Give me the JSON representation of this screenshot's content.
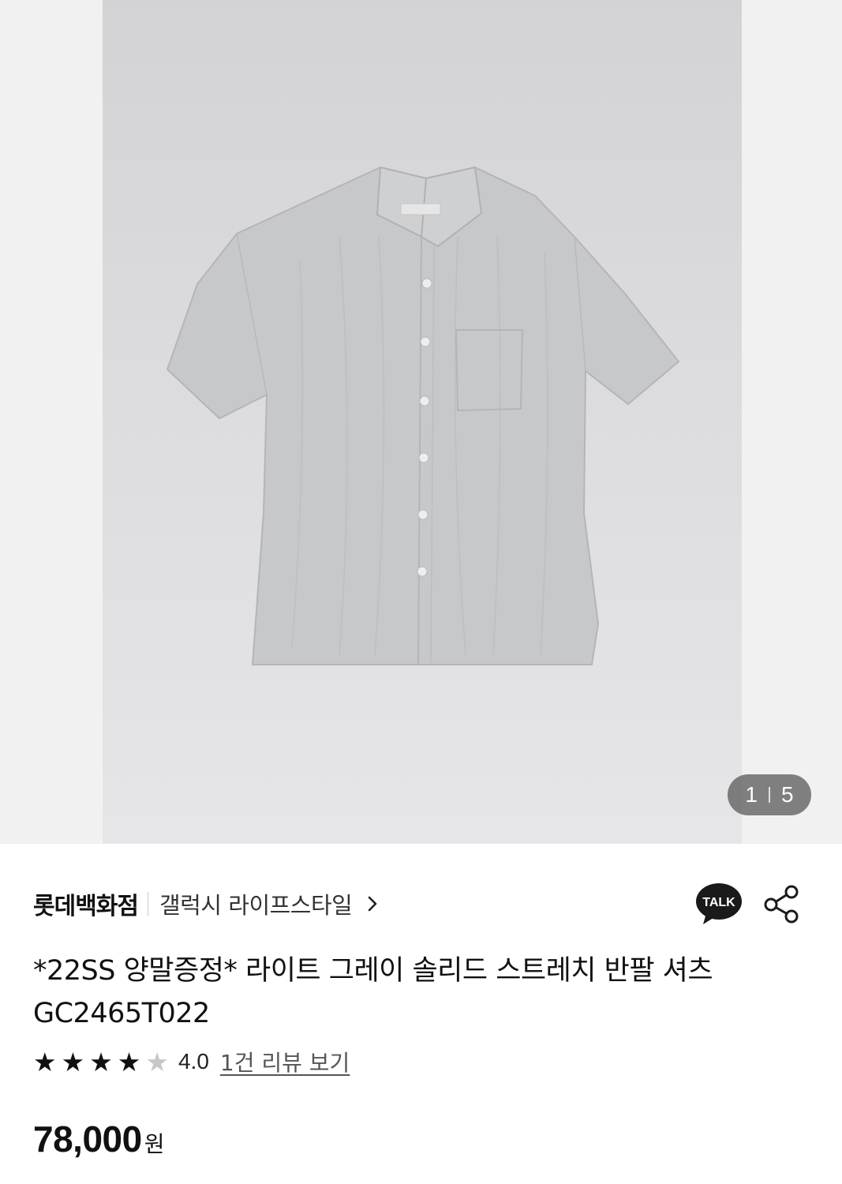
{
  "gallery": {
    "image_subject": "light gray short-sleeve button shirt",
    "current_index": "1",
    "total": "5"
  },
  "seller": {
    "mall_name": "롯데백화점",
    "store_name": "갤럭시 라이프스타일",
    "chevron_icon": "chevron-right-icon",
    "talk_icon": "kakaotalk-icon",
    "talk_label": "TALK",
    "share_icon": "share-icon"
  },
  "product": {
    "title": "*22SS 양말증정* 라이트 그레이 솔리드 스트레치 반팔 셔츠 GC2465T022",
    "rating": 4,
    "max_rating": 5,
    "rating_text": "4.0",
    "review_link": "1건 리뷰 보기",
    "price": "78,000",
    "currency": "원"
  },
  "colors": {
    "text": "#111111",
    "star_filled": "#111111",
    "star_empty": "#c7c7c7",
    "talk_bubble": "#1a1a1a"
  }
}
